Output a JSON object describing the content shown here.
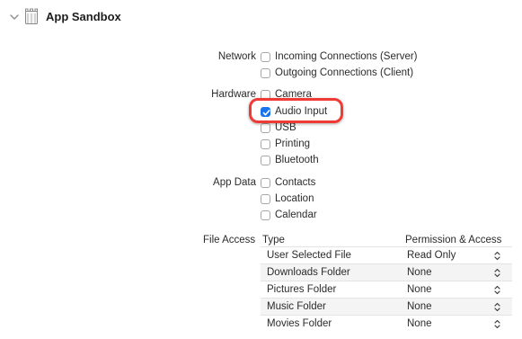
{
  "section": {
    "title": "App Sandbox"
  },
  "network": {
    "label": "Network",
    "items": [
      {
        "label": "Incoming Connections (Server)",
        "checked": false
      },
      {
        "label": "Outgoing Connections (Client)",
        "checked": false
      }
    ]
  },
  "hardware": {
    "label": "Hardware",
    "items": [
      {
        "label": "Camera",
        "checked": false
      },
      {
        "label": "Audio Input",
        "checked": true
      },
      {
        "label": "USB",
        "checked": false
      },
      {
        "label": "Printing",
        "checked": false
      },
      {
        "label": "Bluetooth",
        "checked": false
      }
    ]
  },
  "app_data": {
    "label": "App Data",
    "items": [
      {
        "label": "Contacts",
        "checked": false
      },
      {
        "label": "Location",
        "checked": false
      },
      {
        "label": "Calendar",
        "checked": false
      }
    ]
  },
  "file_access": {
    "label": "File Access",
    "columns": [
      "Type",
      "Permission & Access"
    ],
    "rows": [
      {
        "type": "User Selected File",
        "permission": "Read Only"
      },
      {
        "type": "Downloads Folder",
        "permission": "None"
      },
      {
        "type": "Pictures Folder",
        "permission": "None"
      },
      {
        "type": "Music Folder",
        "permission": "None"
      },
      {
        "type": "Movies Folder",
        "permission": "None"
      }
    ]
  },
  "colors": {
    "accent": "#1a73e8",
    "highlight": "#f03a36"
  },
  "icons": {
    "disclosure": "chevron-down-icon",
    "capability": "sandbox-icon",
    "popup": "updown-arrows-icon"
  }
}
